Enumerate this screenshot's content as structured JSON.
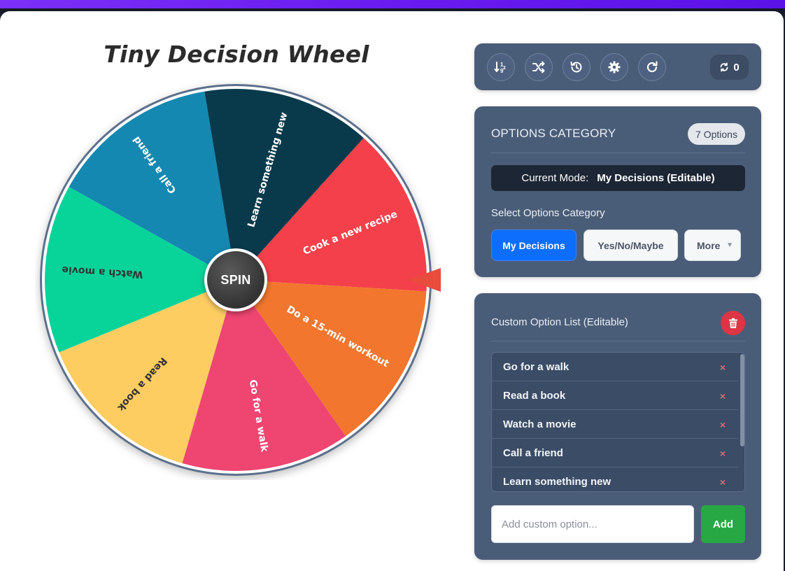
{
  "app": {
    "title": "Tiny Decision Wheel",
    "spin_label": "SPIN"
  },
  "wheel": {
    "segments": [
      {
        "label": "Cook a new recipe",
        "color": "#f4404a",
        "text_color": "#ffffff"
      },
      {
        "label": "Do a 15-min workout",
        "color": "#f2762d",
        "text_color": "#ffffff"
      },
      {
        "label": "Go for a walk",
        "color": "#ee4571",
        "text_color": "#ffffff"
      },
      {
        "label": "Read a book",
        "color": "#fdcd62",
        "text_color": "#333333"
      },
      {
        "label": "Watch a movie",
        "color": "#08d49a",
        "text_color": "#333333"
      },
      {
        "label": "Call a friend",
        "color": "#1488b0",
        "text_color": "#ffffff"
      },
      {
        "label": "Learn something new",
        "color": "#093a4c",
        "text_color": "#ffffff"
      }
    ],
    "pointer_color": "#e74c3c"
  },
  "toolbar": {
    "buttons": [
      {
        "name": "sort-icon"
      },
      {
        "name": "shuffle-icon"
      },
      {
        "name": "history-icon"
      },
      {
        "name": "gear-icon"
      },
      {
        "name": "reset-icon"
      }
    ],
    "spin_count": "0"
  },
  "category": {
    "title": "OPTIONS CATEGORY",
    "count_badge": "7 Options",
    "mode_label": "Current Mode:",
    "mode_value": "My Decisions (Editable)",
    "select_label": "Select Options Category",
    "buttons": {
      "my_decisions": "My Decisions",
      "yes_no_maybe": "Yes/No/Maybe",
      "more": "More"
    }
  },
  "custom_list": {
    "title": "Custom Option List (Editable)",
    "items": [
      "Go for a walk",
      "Read a book",
      "Watch a movie",
      "Call a friend",
      "Learn something new"
    ],
    "remove_glyph": "×",
    "input_placeholder": "Add custom option...",
    "add_label": "Add"
  }
}
